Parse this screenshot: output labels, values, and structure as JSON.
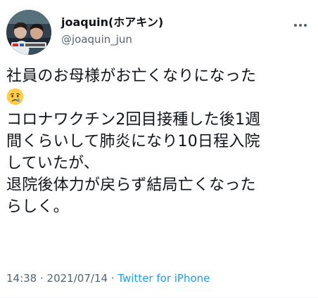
{
  "user": {
    "display_name": "joaquin(ホアキン)",
    "handle": "@joaquin_jun"
  },
  "tweet": {
    "lines": [
      "社員のお母様がお亡くなりになった",
      "コロナワクチン2回目接種した後1週",
      "間くらいして肺炎になり10日程入院",
      "していたが、",
      "退院後体力が戻らず結局亡くなった",
      "らしく。"
    ],
    "emoji": "crying-face-emoji"
  },
  "meta": {
    "time": "14:38",
    "sep1": " · ",
    "date": "2021/07/14",
    "sep2": " · ",
    "source": "Twitter for iPhone"
  },
  "colors": {
    "text": "#0f1419",
    "secondary": "#536471",
    "link": "#1d9bf0"
  },
  "icons": {
    "more": "more-dots-icon"
  }
}
